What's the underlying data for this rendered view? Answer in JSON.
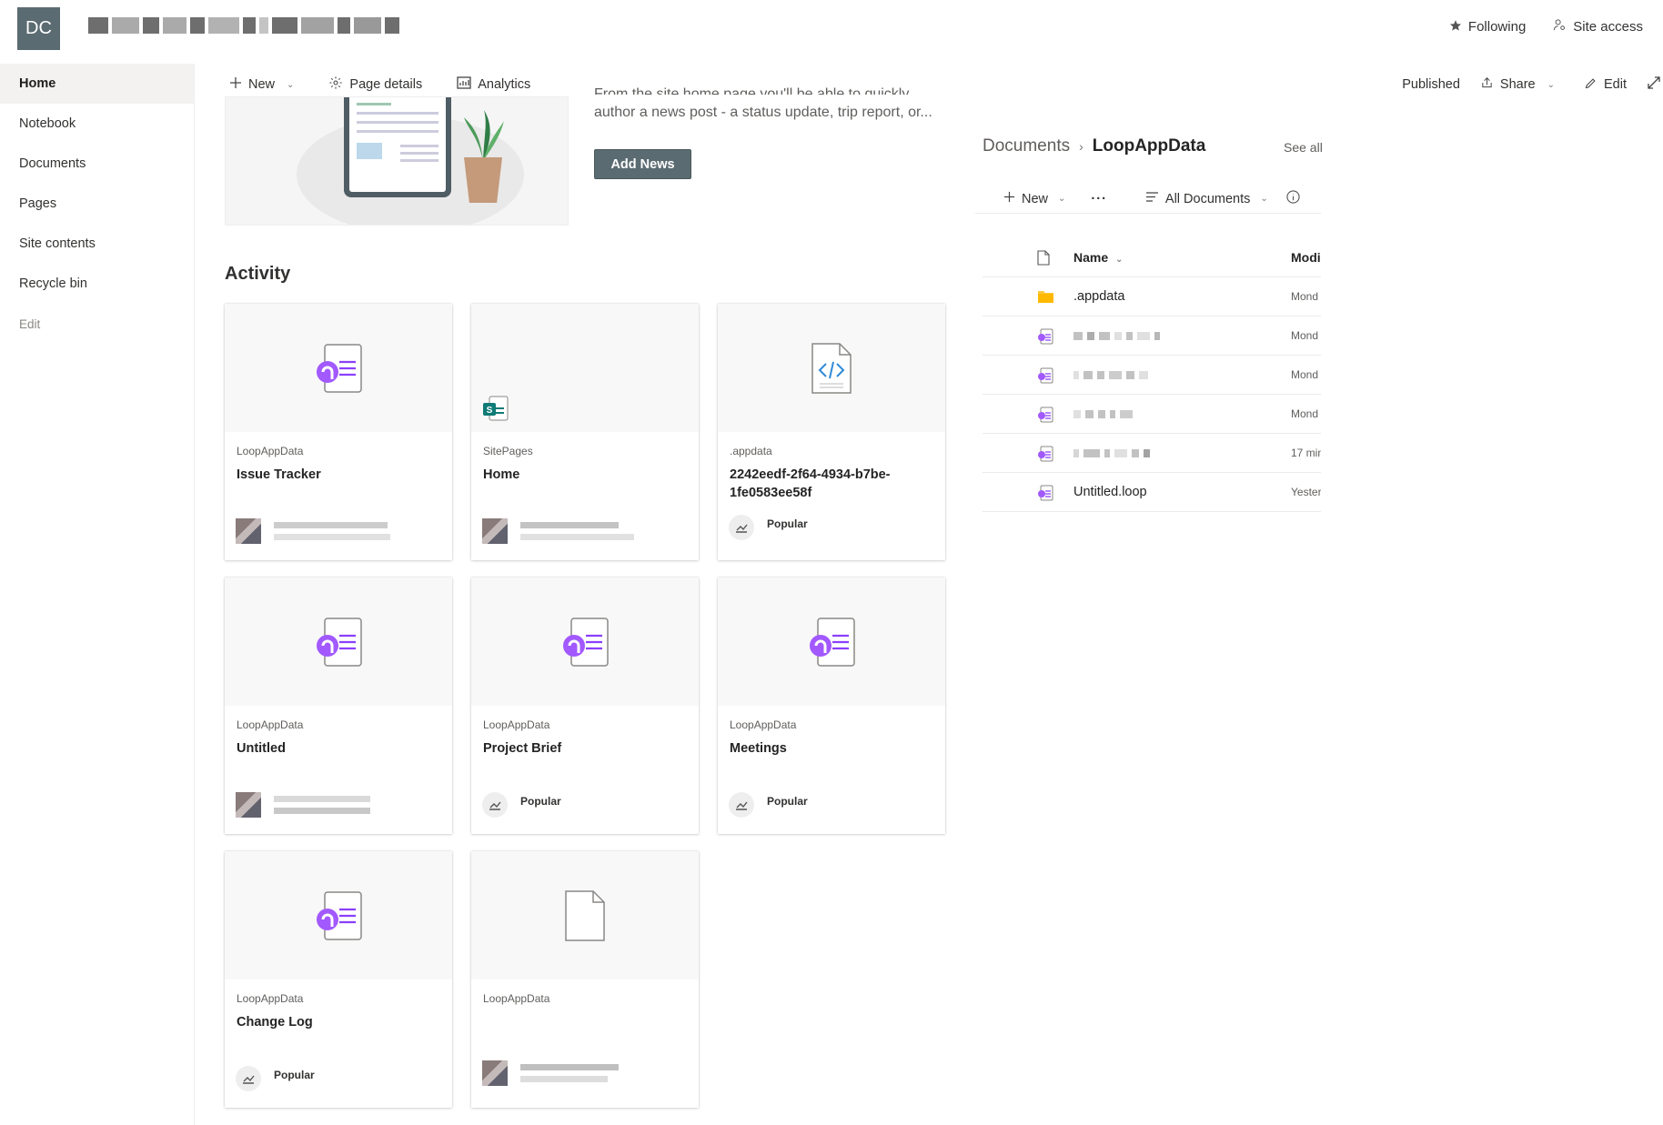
{
  "header": {
    "logo_initials": "DC",
    "following_label": "Following",
    "site_access_label": "Site access"
  },
  "leftnav": {
    "items": [
      {
        "label": "Home",
        "active": true
      },
      {
        "label": "Notebook"
      },
      {
        "label": "Documents"
      },
      {
        "label": "Pages"
      },
      {
        "label": "Site contents"
      },
      {
        "label": "Recycle bin"
      }
    ],
    "edit_label": "Edit"
  },
  "command_bar": {
    "new_label": "New",
    "page_details_label": "Page details",
    "analytics_label": "Analytics",
    "published_label": "Published",
    "share_label": "Share",
    "edit_label": "Edit"
  },
  "news": {
    "text_line1": "From the site home page you'll be able to quickly",
    "text_line2": "author a news post - a status update, trip report, or...",
    "add_news_label": "Add News"
  },
  "activity": {
    "title": "Activity",
    "cards": [
      {
        "location": "LoopAppData",
        "name": "Issue Tracker",
        "thumb": "loop",
        "footer": "person"
      },
      {
        "location": "SitePages",
        "name": "Home",
        "thumb": "sharepoint",
        "footer": "person"
      },
      {
        "location": ".appdata",
        "name": "2242eedf-2f64-4934-b7be-1fe0583ee58f",
        "thumb": "code",
        "footer": "popular"
      },
      {
        "location": "LoopAppData",
        "name": "Untitled",
        "thumb": "loop",
        "footer": "person"
      },
      {
        "location": "LoopAppData",
        "name": "Project Brief",
        "thumb": "loop",
        "footer": "popular"
      },
      {
        "location": "LoopAppData",
        "name": "Meetings",
        "thumb": "loop",
        "footer": "popular"
      },
      {
        "location": "LoopAppData",
        "name": "Change Log",
        "thumb": "loop",
        "footer": "popular"
      },
      {
        "location": "LoopAppData",
        "name": "",
        "thumb": "file",
        "footer": "person"
      }
    ],
    "popular_label": "Popular"
  },
  "documents": {
    "breadcrumb_root": "Documents",
    "breadcrumb_current": "LoopAppData",
    "see_all_label": "See all",
    "new_label": "New",
    "more_label": "···",
    "view_label": "All Documents",
    "columns": {
      "name": "Name",
      "modified": "Modi"
    },
    "rows": [
      {
        "name": ".appdata",
        "type": "folder",
        "modified": "Mond"
      },
      {
        "name": "",
        "type": "loop",
        "modified": "Mond"
      },
      {
        "name": "",
        "type": "loop",
        "modified": "Mond"
      },
      {
        "name": "",
        "type": "loop",
        "modified": "Mond"
      },
      {
        "name": "",
        "type": "loop",
        "modified": "17 min"
      },
      {
        "name": "Untitled.loop",
        "type": "loop",
        "modified": "Yester"
      }
    ]
  },
  "colors": {
    "brand": "#5b6b72",
    "loop_purple": "#8a3ffc",
    "folder_yellow": "#ffc83d"
  }
}
